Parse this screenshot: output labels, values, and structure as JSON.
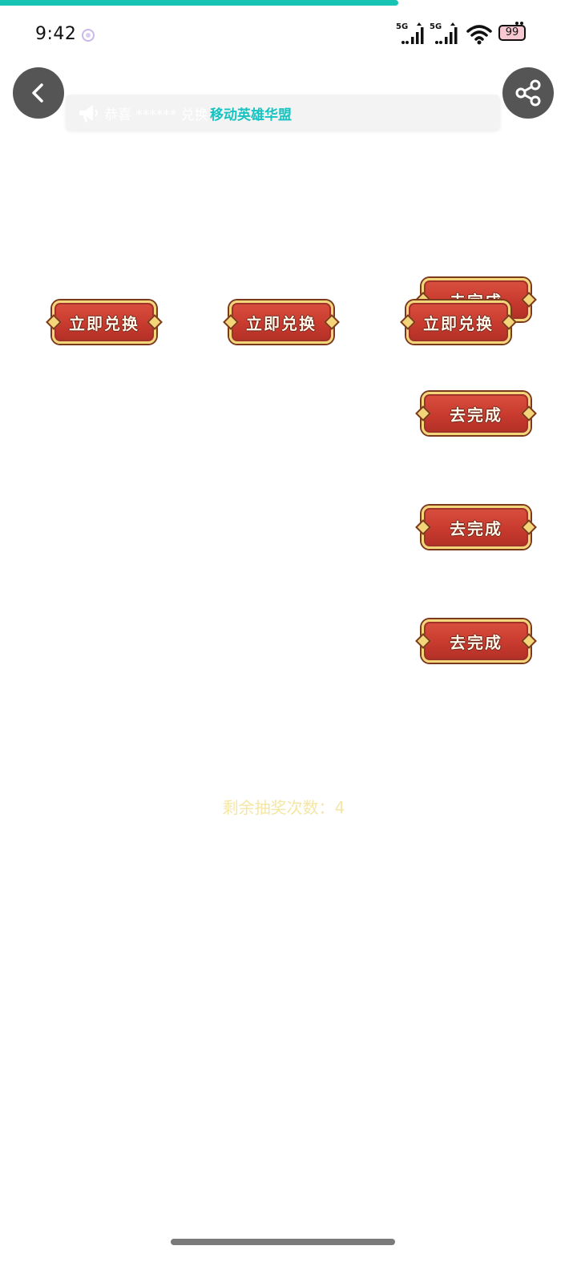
{
  "progress": {
    "fraction": 0.69,
    "color": "#17c3b2"
  },
  "status_bar": {
    "time": "9:42",
    "network_1": "5G",
    "network_2": "5G",
    "battery_level": "99"
  },
  "nav": {
    "back_icon": "chevron-left-icon",
    "share_icon": "share-icon"
  },
  "notice": {
    "icon": "megaphone-icon",
    "text": "恭喜 ****** 兑换了 ×1",
    "overlay_text": "移动英雄华盟"
  },
  "exchange_buttons": [
    {
      "label": "立即兑换"
    },
    {
      "label": "立即兑换"
    },
    {
      "label": "立即兑换"
    }
  ],
  "task_buttons": [
    {
      "label": "去完成"
    },
    {
      "label": "去完成"
    },
    {
      "label": "去完成"
    },
    {
      "label": "去完成"
    }
  ],
  "lottery": {
    "remaining_label": "剩余抽奖次数：",
    "remaining_count": "4"
  },
  "colors": {
    "accent": "#17c3b2",
    "button_red": "#c83a2e",
    "button_gold": "#f4d67a",
    "remaining_text": "#f4e6a4"
  }
}
